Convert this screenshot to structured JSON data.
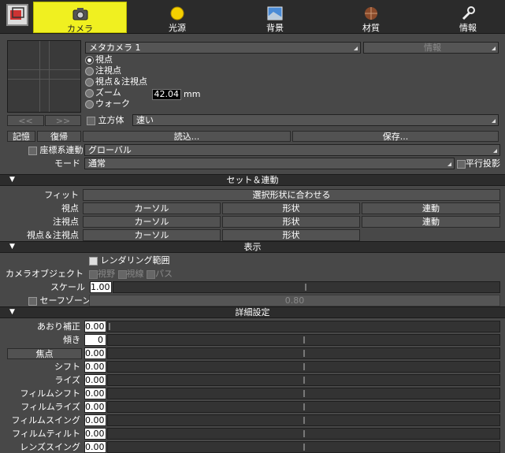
{
  "tabs": [
    {
      "label": "カメラ",
      "icon": "camera-icon",
      "active": true
    },
    {
      "label": "光源",
      "icon": "sun-icon"
    },
    {
      "label": "背景",
      "icon": "background-icon"
    },
    {
      "label": "材質",
      "icon": "material-sphere-icon"
    },
    {
      "label": "情報",
      "icon": "wrench-icon"
    }
  ],
  "camera": {
    "name": "メタカメラ 1",
    "info_label": "情報",
    "prev": "<<",
    "next": ">>",
    "modes": [
      "視点",
      "注視点",
      "視点＆注視点",
      "ズーム",
      "ウォーク"
    ],
    "zoom_value": "42.04",
    "zoom_unit": "mm",
    "stereo_label": "立方体",
    "speed": "速い"
  },
  "actions": {
    "memory": "記憶",
    "restore": "復帰",
    "load": "読込...",
    "save": "保存..."
  },
  "coord_link_label": "座標系連動",
  "coord_value": "グローバル",
  "mode_label": "モード",
  "mode_value": "通常",
  "parallel_label": "平行投影",
  "set_link": {
    "header": "セット＆連動",
    "fit_label": "フィット",
    "fit_button": "選択形状に合わせる",
    "rows": [
      {
        "label": "視点",
        "b1": "カーソル",
        "b2": "形状",
        "b3": "連動"
      },
      {
        "label": "注視点",
        "b1": "カーソル",
        "b2": "形状",
        "b3": "連動"
      },
      {
        "label": "視点＆注視点",
        "b1": "カーソル",
        "b2": "形状"
      }
    ]
  },
  "display": {
    "header": "表示",
    "render_range": "レンダリング範囲",
    "camera_object": "カメラオブジェクト",
    "visibility": "視野",
    "sight": "視線",
    "path": "パス",
    "scale_label": "スケール",
    "scale_value": "1.00",
    "safe_zone": "セーフゾーン",
    "safe_zone_value": "0.80"
  },
  "detail": {
    "header": "詳細設定",
    "focus_button": "焦点",
    "rows": [
      {
        "label": "あおり補正",
        "value": "0.00"
      },
      {
        "label": "傾き",
        "value": "0"
      },
      {
        "label": "",
        "value": "0.00"
      },
      {
        "label": "シフト",
        "value": "0.00"
      },
      {
        "label": "ライズ",
        "value": "0.00"
      },
      {
        "label": "フィルムシフト",
        "value": "0.00"
      },
      {
        "label": "フィルムライズ",
        "value": "0.00"
      },
      {
        "label": "フィルムスイング",
        "value": "0.00"
      },
      {
        "label": "フィルムティルト",
        "value": "0.00"
      },
      {
        "label": "レンズスイング",
        "value": "0.00"
      }
    ]
  }
}
